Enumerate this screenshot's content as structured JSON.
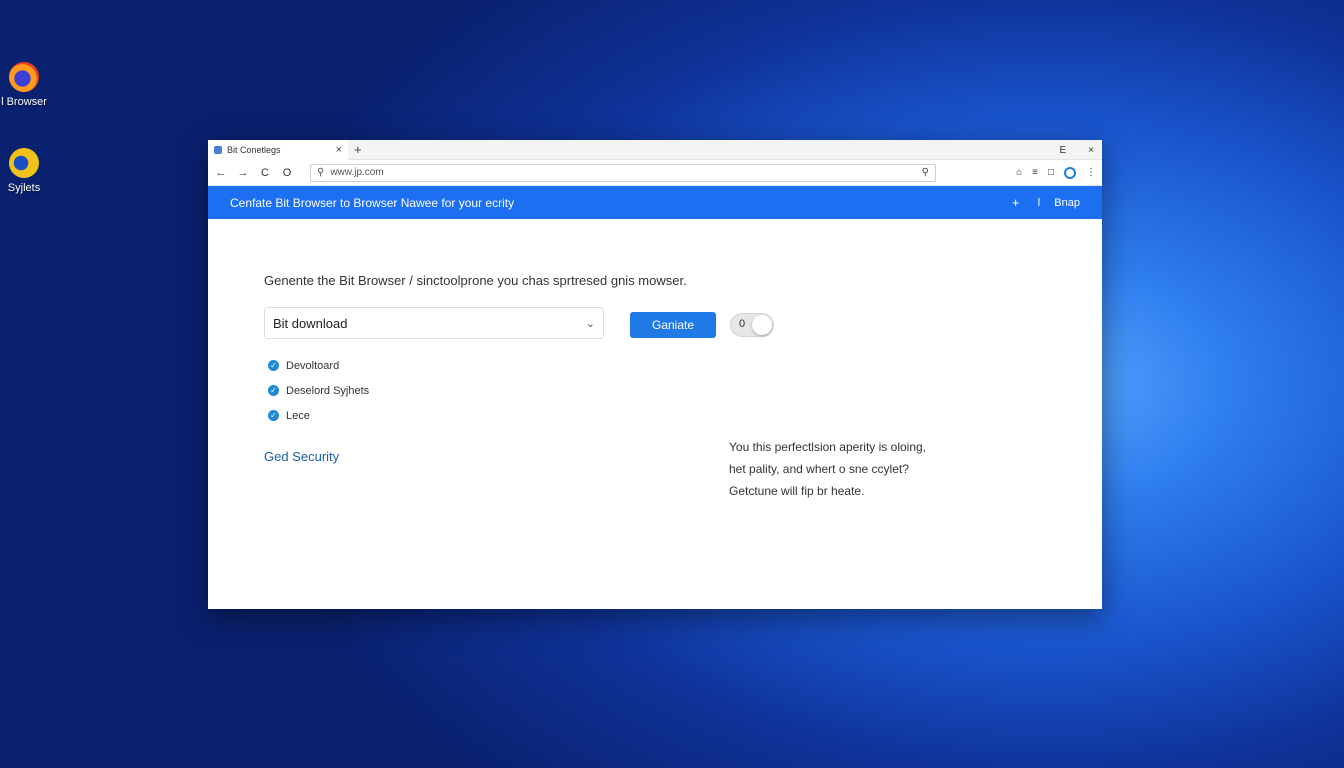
{
  "desktop": {
    "icons": [
      {
        "label": "l Browser",
        "icon": "firefox-icon"
      },
      {
        "label": "Syjlets",
        "icon": "app-icon"
      }
    ]
  },
  "browser": {
    "tab_title": "Bit Conetlegs",
    "tab_close": "×",
    "new_tab": "+",
    "window_controls": {
      "minimize": "E",
      "close": "×"
    },
    "nav": {
      "back": "←",
      "forward": "→",
      "reload": "C",
      "home": "O"
    },
    "url": "www.jp.com",
    "toolbar_icons": [
      "home-icon",
      "bookmark-icon",
      "extensions-icon",
      "profile-icon",
      "menu-icon"
    ]
  },
  "banner": {
    "text": "Cenfate Bit Browser to Browser Nawee for your ecrity",
    "plus": "+",
    "info": "ǀ",
    "action": "Bnap"
  },
  "main": {
    "intro": "Genente the Bit Browser / sinctoolprone you chas sprtresed gnis mowser.",
    "select_value": "Bit download",
    "generate_label": "Ganiate",
    "toggle_value": "0",
    "checklist": [
      "Devoltoard",
      "Deselord Syjhets",
      "Lece"
    ],
    "link": "Ged Security",
    "note_lines": [
      "You this perfectlsion aperity is oloing,",
      "het pality, and whert o sne ccylet?",
      "Getctune will fip br heate."
    ]
  },
  "colors": {
    "banner": "#1c6ff0",
    "button": "#1f7ae6",
    "link": "#1a5fa8"
  }
}
